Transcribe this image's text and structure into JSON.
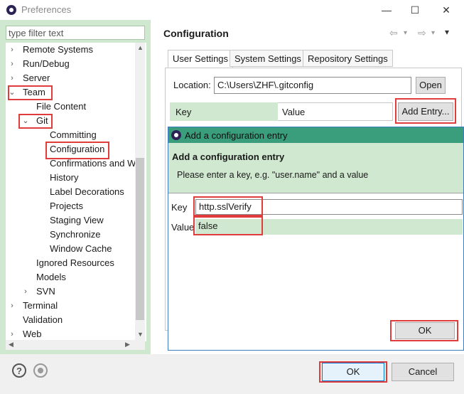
{
  "window": {
    "title": "Preferences",
    "minimize": "—",
    "maximize": "☐",
    "close": "✕"
  },
  "filter": {
    "placeholder": "type filter text"
  },
  "tree": [
    {
      "label": "Remote Systems",
      "caret": "›",
      "indent": 0
    },
    {
      "label": "Run/Debug",
      "caret": "›",
      "indent": 0
    },
    {
      "label": "Server",
      "caret": "›",
      "indent": 0
    },
    {
      "label": "Team",
      "caret": "⌄",
      "indent": 0
    },
    {
      "label": "File Content",
      "caret": "",
      "indent": 1
    },
    {
      "label": "Git",
      "caret": "⌄",
      "indent": 1
    },
    {
      "label": "Committing",
      "caret": "",
      "indent": 2
    },
    {
      "label": "Configuration",
      "caret": "",
      "indent": 2
    },
    {
      "label": "Confirmations and W",
      "caret": "",
      "indent": 2
    },
    {
      "label": "History",
      "caret": "",
      "indent": 2
    },
    {
      "label": "Label Decorations",
      "caret": "",
      "indent": 2
    },
    {
      "label": "Projects",
      "caret": "",
      "indent": 2
    },
    {
      "label": "Staging View",
      "caret": "",
      "indent": 2
    },
    {
      "label": "Synchronize",
      "caret": "",
      "indent": 2
    },
    {
      "label": "Window Cache",
      "caret": "",
      "indent": 2
    },
    {
      "label": "Ignored Resources",
      "caret": "",
      "indent": 1
    },
    {
      "label": "Models",
      "caret": "",
      "indent": 1
    },
    {
      "label": "SVN",
      "caret": "›",
      "indent": 1
    },
    {
      "label": "Terminal",
      "caret": "›",
      "indent": 0
    },
    {
      "label": "Validation",
      "caret": "",
      "indent": 0
    },
    {
      "label": "Web",
      "caret": "›",
      "indent": 0
    }
  ],
  "page": {
    "title": "Configuration",
    "nav_back": "⇦",
    "nav_back_menu": "▾",
    "nav_forward": "⇨",
    "nav_forward_menu": "▾",
    "view_menu": "▾",
    "tabs": [
      "User Settings",
      "System Settings",
      "Repository Settings"
    ],
    "location_label": "Location:",
    "location_value": "C:\\Users\\ZHF\\.gitconfig",
    "open_button": "Open",
    "add_entry_button": "Add Entry...",
    "columns": [
      "Key",
      "Value"
    ]
  },
  "dialog": {
    "title": "Add a configuration entry",
    "heading": "Add a configuration entry",
    "description": "Please enter a key, e.g. \"user.name\" and a value",
    "key_label": "Key",
    "key_value": "http.sslVerify",
    "value_label": "Value",
    "value_value": "false",
    "ok_button": "OK"
  },
  "bottom": {
    "help_icon": "?",
    "ok_button": "OK",
    "cancel_button": "Cancel"
  },
  "colors": {
    "highlight": "#e03c3c",
    "panel_green": "#cfe8cf",
    "dialog_titlebar": "#3a9e7c"
  }
}
